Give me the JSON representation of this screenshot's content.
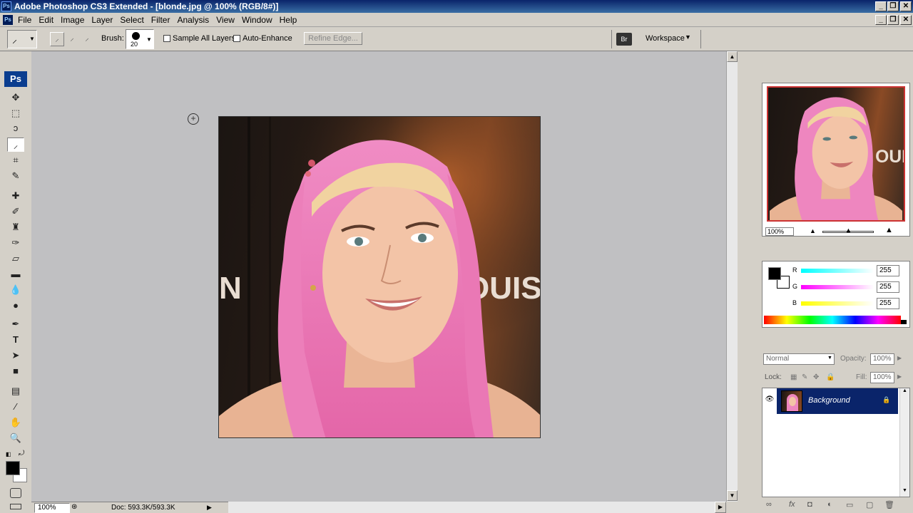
{
  "window": {
    "title": "Adobe Photoshop CS3 Extended - [blonde.jpg @ 100% (RGB/8#)]",
    "app_icon_text": "Ps",
    "minimize_icon": "minimize-icon",
    "maximize_icon": "maximize-icon",
    "close_icon": "close-icon"
  },
  "menu": {
    "items": [
      "File",
      "Edit",
      "Image",
      "Layer",
      "Select",
      "Filter",
      "Analysis",
      "View",
      "Window",
      "Help"
    ]
  },
  "options_bar": {
    "brush_label": "Brush:",
    "brush_size": "20",
    "sample_all_layers": "Sample All Layers",
    "auto_enhance": "Auto-Enhance",
    "refine_edge": "Refine Edge...",
    "workspace": "Workspace"
  },
  "toolbox": {
    "logo": "Ps"
  },
  "photo": {
    "sign_text_left": "N",
    "sign_text_right": "OUIS",
    "accent_hair": "#f07ab8",
    "skin": "#f2c2a8"
  },
  "status_bar": {
    "zoom": "100%",
    "doc_info": "Doc: 593.3K/593.3K"
  },
  "navigator": {
    "zoom": "100%",
    "view_box_color": "#cc3333",
    "thumb_sign_text": "OUI"
  },
  "color_panel": {
    "channels": [
      {
        "label": "R",
        "value": "255",
        "gradient_from": "#00ffff",
        "gradient_to": "#ffffff"
      },
      {
        "label": "G",
        "value": "255",
        "gradient_from": "#ff00ff",
        "gradient_to": "#ffffff"
      },
      {
        "label": "B",
        "value": "255",
        "gradient_from": "#ffff00",
        "gradient_to": "#ffffff"
      }
    ],
    "foreground": "#000000",
    "background": "#ffffff"
  },
  "layers_panel": {
    "blend_mode": "Normal",
    "opacity_label": "Opacity:",
    "opacity_value": "100%",
    "lock_label": "Lock:",
    "fill_label": "Fill:",
    "fill_value": "100%",
    "layers": [
      {
        "name": "Background",
        "selected": true
      }
    ],
    "selection_color": "#0a246a"
  }
}
